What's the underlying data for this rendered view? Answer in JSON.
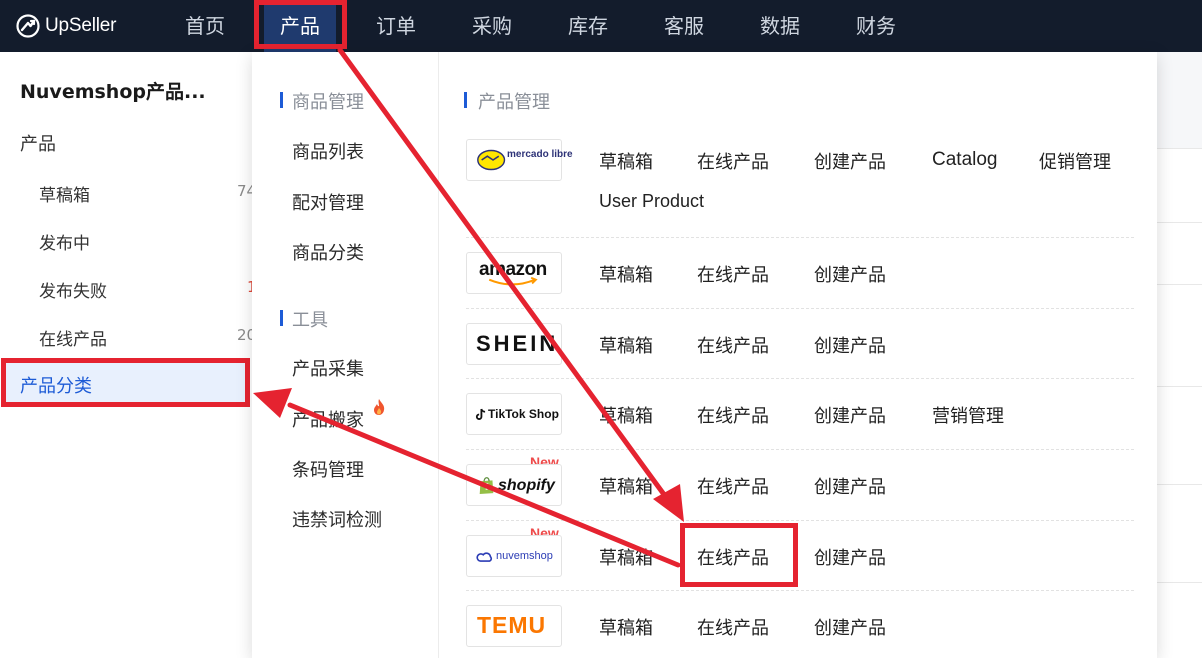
{
  "app": {
    "logo_text": "UpSeller",
    "brand_color": "#131c2c",
    "accent_color": "#1d5bd6",
    "annotation_color": "#e52330"
  },
  "nav": {
    "items": [
      {
        "label": "首页"
      },
      {
        "label": "产品"
      },
      {
        "label": "订单"
      },
      {
        "label": "采购"
      },
      {
        "label": "库存"
      },
      {
        "label": "客服"
      },
      {
        "label": "数据"
      },
      {
        "label": "财务"
      }
    ],
    "active": "产品"
  },
  "sidebar": {
    "title": "Nuvemshop产品...",
    "group": "产品",
    "items": [
      {
        "label": "草稿箱",
        "count": "74"
      },
      {
        "label": "发布中",
        "count": ""
      },
      {
        "label": "发布失败",
        "count": "1"
      },
      {
        "label": "在线产品",
        "count": "20"
      }
    ],
    "active_label": "产品分类"
  },
  "dropdown": {
    "left": {
      "section1": "商品管理",
      "section1_links": [
        "商品列表",
        "配对管理",
        "商品分类"
      ],
      "section2": "工具",
      "section2_links": [
        "产品采集",
        "产品搬家",
        "条码管理",
        "违禁词检测"
      ],
      "hot_icon": "fire-icon"
    },
    "right_title": "产品管理",
    "platforms": [
      {
        "name": "mercado libre",
        "links": [
          "草稿箱",
          "在线产品",
          "创建产品",
          "Catalog",
          "促销管理",
          "User Product"
        ],
        "badge": ""
      },
      {
        "name": "amazon",
        "links": [
          "草稿箱",
          "在线产品",
          "创建产品"
        ],
        "badge": ""
      },
      {
        "name": "SHEIN",
        "links": [
          "草稿箱",
          "在线产品",
          "创建产品"
        ],
        "badge": ""
      },
      {
        "name": "TikTok Shop",
        "links": [
          "草稿箱",
          "在线产品",
          "创建产品",
          "营销管理"
        ],
        "badge": ""
      },
      {
        "name": "shopify",
        "links": [
          "草稿箱",
          "在线产品",
          "创建产品"
        ],
        "badge": "New"
      },
      {
        "name": "nuvemshop",
        "links": [
          "草稿箱",
          "在线产品",
          "创建产品"
        ],
        "badge": "New"
      },
      {
        "name": "TEMU",
        "links": [
          "草稿箱",
          "在线产品",
          "创建产品"
        ],
        "badge": ""
      }
    ]
  }
}
